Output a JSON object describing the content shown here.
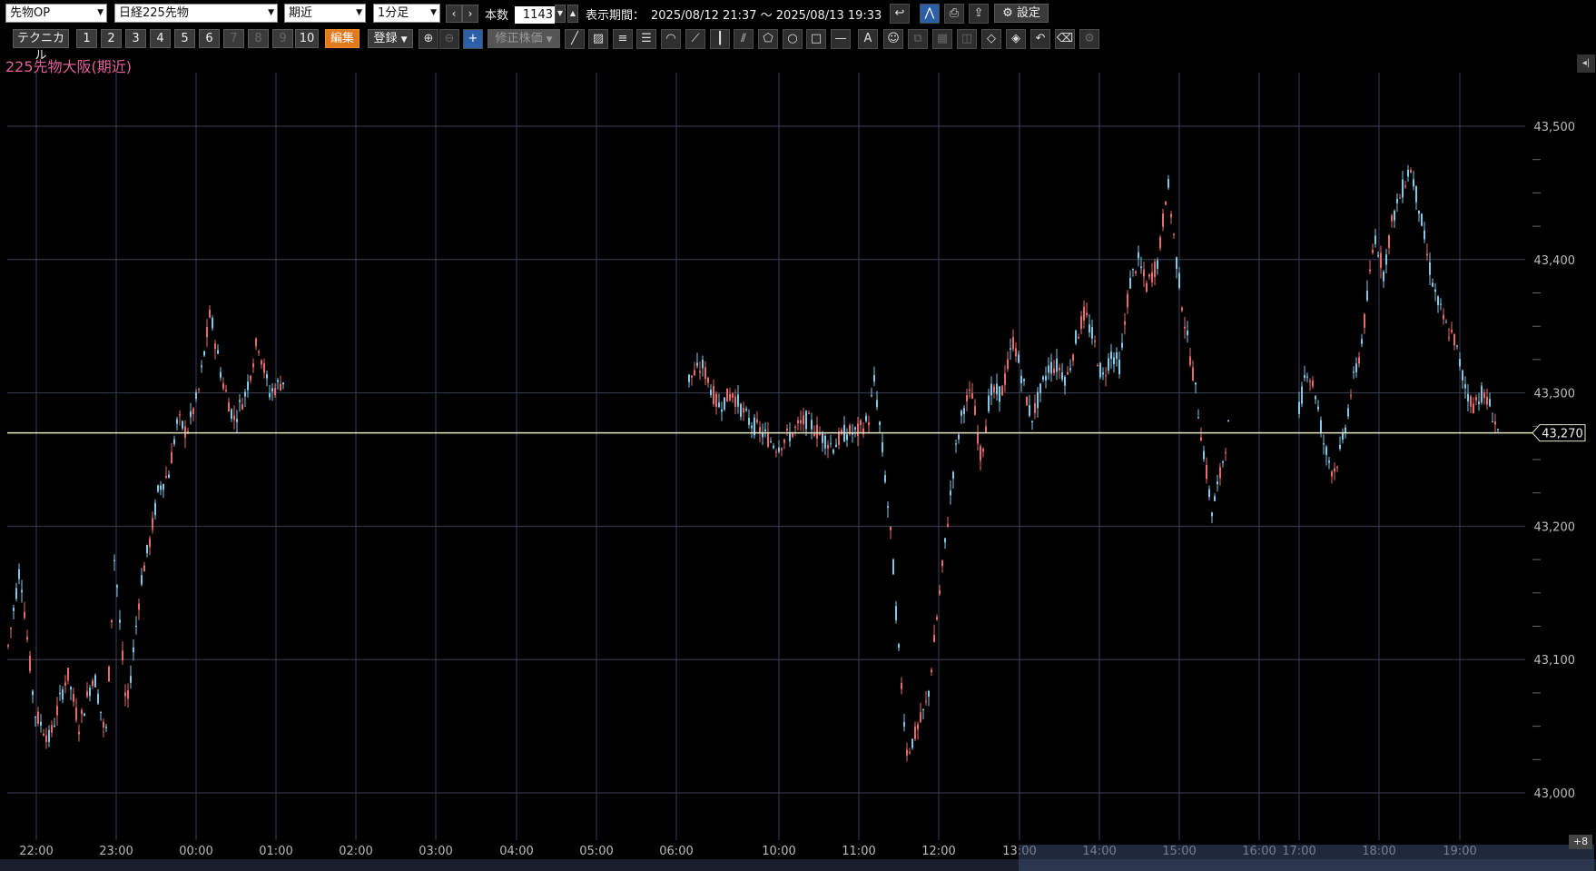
{
  "toolbar": {
    "market_select": "先物OP",
    "product_select": "日経225先物",
    "contract_select": "期近",
    "interval_select": "1分足",
    "bars_label": "本数",
    "bars_value": "1143",
    "period_label": "表示期間：",
    "period_value": "2025/08/12 21:37 ～ 2025/08/13 19:33",
    "settings_label": "設定",
    "technical_label": "テクニカル",
    "slots": [
      "1",
      "2",
      "3",
      "4",
      "5",
      "6",
      "7",
      "8",
      "9",
      "10"
    ],
    "edit_label": "編集",
    "register_label": "登録",
    "adjusted_label": "修正株価"
  },
  "icons": {
    "row1": [
      "undo-icon",
      "chart-mode-icon",
      "print-icon",
      "export-icon",
      "gear-icon"
    ],
    "row2": [
      "zoom-in-icon",
      "zoom-out-icon",
      "crosshair-icon",
      "trendline-icon",
      "ruler-icon",
      "hlines-icon",
      "fibonacci-icon",
      "arc-icon",
      "fan-icon",
      "vlines-icon",
      "channel-icon",
      "polygon-icon",
      "circle-icon",
      "rectangle-icon",
      "hline-icon",
      "text-icon",
      "stamp-icon",
      "copy-icon",
      "grid-icon",
      "eraser-icon",
      "eraser2-icon",
      "eraser3-icon",
      "undo2-icon",
      "clear-icon",
      "tool-settings-icon"
    ]
  },
  "chart_title": "225先物大阪(期近)",
  "current_price_label": "43,270",
  "nav_badge": "+8",
  "colors": {
    "up": "#e86a6a",
    "down": "#7ec8e8",
    "title": "#e0609a",
    "grid": "#3a4055",
    "price_line": "#e8e6c8"
  },
  "chart_data": {
    "type": "candlestick",
    "ylim": [
      42985,
      43545
    ],
    "y_ticks": [
      "43,500",
      "43,400",
      "43,300",
      "43,200",
      "43,100",
      "43,000"
    ],
    "y_tick_values": [
      43500,
      43400,
      43300,
      43200,
      43100,
      43000
    ],
    "x_ticks": [
      "22:00",
      "23:00",
      "00:00",
      "01:00",
      "02:00",
      "03:00",
      "04:00",
      "05:00",
      "06:00",
      "10:00",
      "11:00",
      "12:00",
      "13:00",
      "14:00",
      "15:00",
      "16:00",
      "17:00",
      "18:00",
      "19:00"
    ],
    "current_price": 43270,
    "price_path": [
      [
        0,
        43110
      ],
      [
        4,
        43170
      ],
      [
        9,
        43060
      ],
      [
        14,
        43040
      ],
      [
        20,
        43090
      ],
      [
        24,
        43050
      ],
      [
        29,
        43090
      ],
      [
        33,
        43040
      ],
      [
        36,
        43180
      ],
      [
        40,
        43060
      ],
      [
        45,
        43160
      ],
      [
        48,
        43190
      ],
      [
        51,
        43230
      ],
      [
        54,
        43240
      ],
      [
        57,
        43280
      ],
      [
        60,
        43270
      ],
      [
        64,
        43300
      ],
      [
        68,
        43360
      ],
      [
        72,
        43310
      ],
      [
        76,
        43280
      ],
      [
        80,
        43300
      ],
      [
        84,
        43340
      ],
      [
        88,
        43300
      ],
      [
        93,
        43310
      ],
      [
        98,
        43320
      ],
      [
        103,
        43290
      ],
      [
        108,
        43300
      ],
      [
        113,
        43280
      ],
      [
        118,
        43270
      ],
      [
        123,
        43260
      ],
      [
        128,
        43270
      ],
      [
        133,
        43280
      ],
      [
        137,
        43270
      ],
      [
        142,
        43260
      ],
      [
        146,
        43270
      ],
      [
        150,
        43270
      ],
      [
        154,
        43280
      ],
      [
        156,
        43310
      ],
      [
        159,
        43250
      ],
      [
        162,
        43180
      ],
      [
        164,
        43110
      ],
      [
        167,
        43030
      ],
      [
        171,
        43050
      ],
      [
        174,
        43070
      ],
      [
        177,
        43130
      ],
      [
        180,
        43190
      ],
      [
        183,
        43250
      ],
      [
        186,
        43290
      ],
      [
        189,
        43300
      ],
      [
        192,
        43250
      ],
      [
        195,
        43300
      ],
      [
        199,
        43300
      ],
      [
        203,
        43340
      ],
      [
        206,
        43310
      ],
      [
        209,
        43280
      ],
      [
        212,
        43300
      ],
      [
        215,
        43320
      ],
      [
        218,
        43320
      ],
      [
        221,
        43310
      ],
      [
        224,
        43340
      ],
      [
        227,
        43360
      ],
      [
        230,
        43340
      ],
      [
        233,
        43310
      ],
      [
        236,
        43330
      ],
      [
        239,
        43320
      ],
      [
        242,
        43380
      ],
      [
        245,
        43400
      ],
      [
        248,
        43380
      ],
      [
        252,
        43400
      ],
      [
        255,
        43460
      ],
      [
        258,
        43400
      ],
      [
        261,
        43350
      ],
      [
        264,
        43310
      ],
      [
        267,
        43260
      ],
      [
        270,
        43210
      ],
      [
        273,
        43240
      ],
      [
        276,
        43280
      ],
      [
        279,
        43320
      ],
      [
        282,
        43300
      ],
      [
        285,
        43260
      ],
      [
        288,
        43240
      ],
      [
        291,
        43260
      ],
      [
        294,
        43300
      ],
      [
        297,
        43330
      ],
      [
        299,
        43360
      ],
      [
        302,
        43420
      ],
      [
        305,
        43390
      ],
      [
        308,
        43430
      ],
      [
        311,
        43450
      ],
      [
        314,
        43470
      ],
      [
        317,
        43440
      ],
      [
        320,
        43400
      ],
      [
        323,
        43370
      ],
      [
        326,
        43350
      ],
      [
        329,
        43340
      ],
      [
        332,
        43310
      ],
      [
        335,
        43290
      ],
      [
        338,
        43300
      ],
      [
        341,
        43290
      ],
      [
        344,
        43270
      ]
    ],
    "high": 43480,
    "low": 43020
  }
}
